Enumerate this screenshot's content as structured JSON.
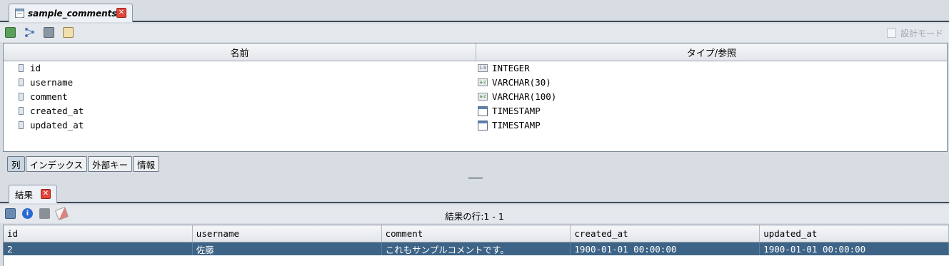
{
  "editor_tab": {
    "title": "sample_comments"
  },
  "toolbar": {
    "design_mode_label": "設計モード"
  },
  "columns_table": {
    "headers": {
      "name": "名前",
      "type": "タイプ/参照"
    },
    "rows": [
      {
        "name": "id",
        "type": "INTEGER",
        "type_icon": "integer-icon",
        "type_icon_text": "1-9"
      },
      {
        "name": "username",
        "type": "VARCHAR(30)",
        "type_icon": "varchar-icon",
        "type_icon_text": "a-z"
      },
      {
        "name": "comment",
        "type": "VARCHAR(100)",
        "type_icon": "varchar-icon",
        "type_icon_text": "a-z"
      },
      {
        "name": "created_at",
        "type": "TIMESTAMP",
        "type_icon": "calendar-icon",
        "type_icon_text": ""
      },
      {
        "name": "updated_at",
        "type": "TIMESTAMP",
        "type_icon": "calendar-icon",
        "type_icon_text": ""
      }
    ]
  },
  "sub_tabs": [
    "列",
    "インデックス",
    "外部キー",
    "情報"
  ],
  "result_tab": {
    "title": "結果"
  },
  "result_toolbar": {
    "row_count": "結果の行:1 - 1"
  },
  "results": {
    "headers": [
      "id",
      "username",
      "comment",
      "created_at",
      "updated_at"
    ],
    "rows": [
      [
        "2",
        "佐藤",
        "これもサンプルコメントです。",
        "1900-01-01 00:00:00",
        "1900-01-01 00:00:00"
      ]
    ]
  },
  "colors": {
    "selected_row": "#3d6386",
    "close_button": "#e0463a"
  }
}
